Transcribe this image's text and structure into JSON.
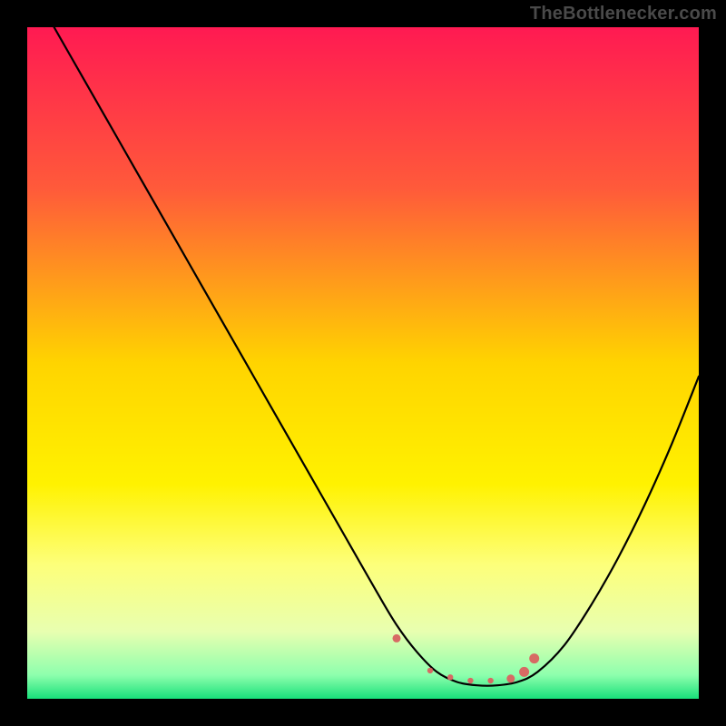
{
  "watermark": "TheBottlenecker.com",
  "chart_data": {
    "type": "line",
    "title": "",
    "xlabel": "",
    "ylabel": "",
    "xlim": [
      0,
      100
    ],
    "ylim": [
      0,
      100
    ],
    "background_gradient_stops": [
      {
        "offset": 0,
        "color": "#ff1a52"
      },
      {
        "offset": 24,
        "color": "#ff5a3a"
      },
      {
        "offset": 50,
        "color": "#ffd400"
      },
      {
        "offset": 68,
        "color": "#fff200"
      },
      {
        "offset": 80,
        "color": "#fdff7a"
      },
      {
        "offset": 90,
        "color": "#e8ffb0"
      },
      {
        "offset": 96.5,
        "color": "#8dffad"
      },
      {
        "offset": 100,
        "color": "#18e07a"
      }
    ],
    "series": [
      {
        "name": "curve",
        "x": [
          4,
          8,
          12,
          16,
          20,
          24,
          28,
          32,
          36,
          40,
          44,
          48,
          52,
          55,
          58,
          61,
          64,
          67,
          70,
          73,
          76,
          80,
          84,
          88,
          92,
          96,
          100
        ],
        "y": [
          100,
          93,
          86,
          79,
          72,
          65,
          58,
          51,
          44,
          37,
          30,
          23,
          16,
          11,
          7,
          4,
          2.5,
          2,
          2,
          2.5,
          4,
          8,
          14,
          21,
          29,
          38,
          48
        ]
      }
    ],
    "highlight_points": {
      "name": "optimal-range-dots",
      "color": "#d76a64",
      "x": [
        55,
        60,
        63,
        66,
        69,
        72,
        74,
        75.5
      ],
      "y": [
        9,
        4.2,
        3.2,
        2.7,
        2.7,
        3.0,
        4.0,
        6.0
      ],
      "r": [
        4.5,
        3.2,
        3.2,
        3.2,
        3.2,
        4.5,
        5.5,
        5.5
      ]
    }
  }
}
